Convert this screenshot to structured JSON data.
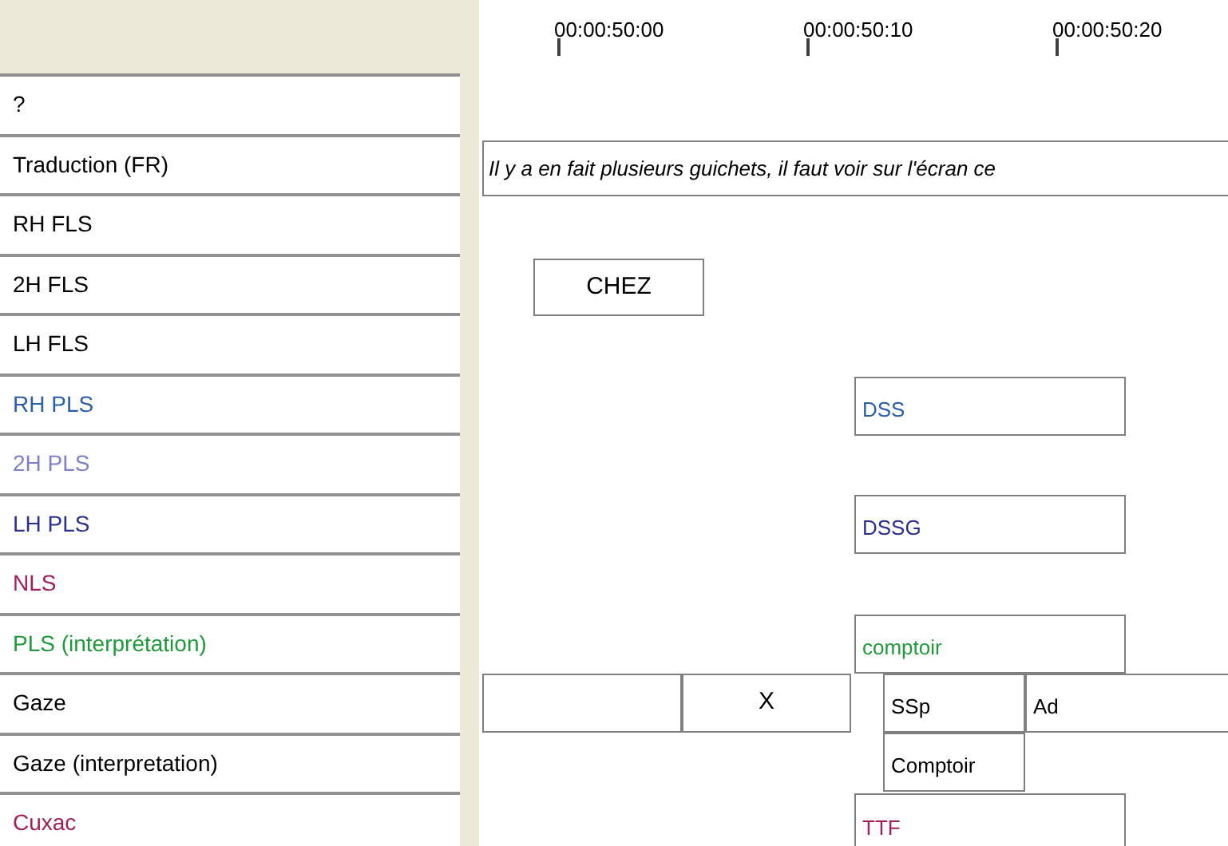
{
  "ruler": [
    {
      "label": "00:00:50:00"
    },
    {
      "label": "00:00:50:10"
    },
    {
      "label": "00:00:50:20"
    }
  ],
  "tiers": [
    {
      "name": "?",
      "color": "#000000"
    },
    {
      "name": "Traduction (FR)",
      "color": "#000000",
      "annotations": [
        {
          "kind": "italic",
          "value": "Il y a en fait plusieurs guichets, il faut voir sur l'écran ce"
        }
      ]
    },
    {
      "name": "RH FLS",
      "color": "#000000"
    },
    {
      "name": "2H FLS",
      "color": "#000000",
      "annotations": [
        {
          "kind": "centered",
          "value": "CHEZ"
        }
      ]
    },
    {
      "name": "LH FLS",
      "color": "#000000"
    },
    {
      "name": "RH PLS",
      "color": "#2a5fa5",
      "annotations": [
        {
          "kind": "text",
          "value": "DSS"
        }
      ]
    },
    {
      "name": "2H PLS",
      "color": "#8080c8"
    },
    {
      "name": "LH PLS",
      "color": "#2b2f8f",
      "annotations": [
        {
          "kind": "text",
          "value": "DSSG"
        }
      ]
    },
    {
      "name": "NLS",
      "color": "#a02060"
    },
    {
      "name": "PLS (interprétation)",
      "color": "#1f9a3a",
      "annotations": [
        {
          "kind": "text",
          "value": "comptoir"
        }
      ]
    },
    {
      "name": "Gaze",
      "color": "#000000",
      "annotations": [
        {
          "kind": "blank"
        },
        {
          "kind": "centered",
          "value": "X"
        },
        {
          "kind": "text",
          "value": "SSp"
        },
        {
          "kind": "text",
          "value": "Ad"
        }
      ]
    },
    {
      "name": "Gaze (interpretation)",
      "color": "#000000",
      "annotations": [
        {
          "kind": "text",
          "value": "Comptoir"
        }
      ]
    },
    {
      "name": "Cuxac",
      "color": "#a0205a",
      "annotations": [
        {
          "kind": "text",
          "value": "TTF"
        }
      ]
    }
  ]
}
